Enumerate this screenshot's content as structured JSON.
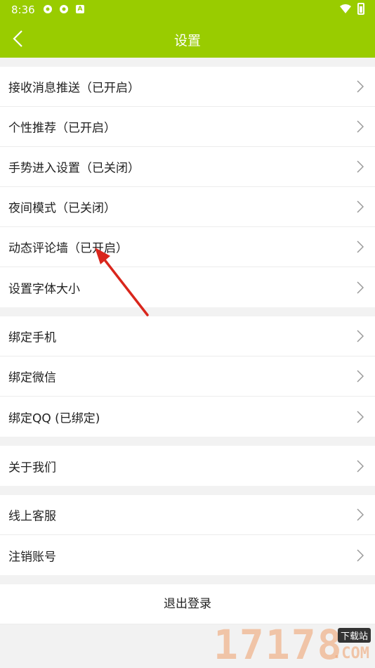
{
  "status_bar": {
    "time": "8:36",
    "small_icon_label": "A"
  },
  "header": {
    "title": "设置"
  },
  "groups": [
    {
      "items": [
        {
          "label": "接收消息推送（已开启）"
        },
        {
          "label": "个性推荐（已开启）"
        },
        {
          "label": "手势进入设置（已关闭）"
        },
        {
          "label": "夜间模式（已关闭）"
        },
        {
          "label": "动态评论墙（已开启）"
        },
        {
          "label": "设置字体大小"
        }
      ]
    },
    {
      "items": [
        {
          "label": "绑定手机"
        },
        {
          "label": "绑定微信"
        },
        {
          "label": "绑定QQ (已绑定)"
        }
      ]
    },
    {
      "items": [
        {
          "label": "关于我们"
        }
      ]
    },
    {
      "items": [
        {
          "label": "线上客服"
        },
        {
          "label": "注销账号"
        }
      ]
    }
  ],
  "logout_label": "退出登录",
  "watermark": {
    "digits": "17178",
    "badge": "下载站",
    "suffix": ".COM"
  },
  "colors": {
    "accent": "#99cc00",
    "annotation_arrow": "#d9261c"
  }
}
